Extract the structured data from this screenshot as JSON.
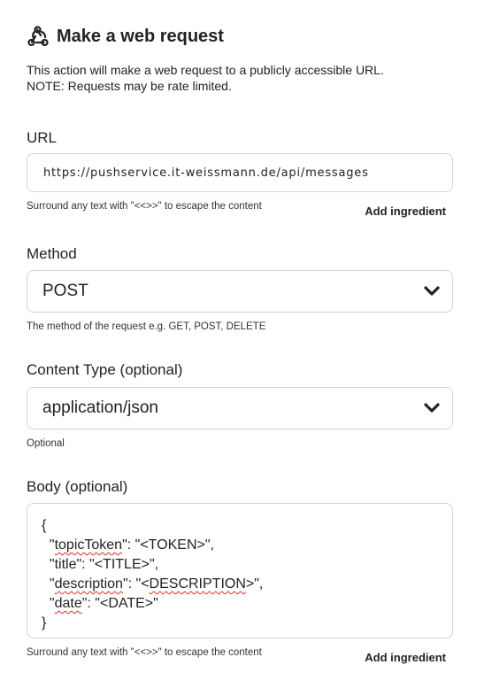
{
  "header": {
    "title": "Make a web request",
    "icon": "webhook-icon"
  },
  "description": {
    "line1": "This action will make a web request to a publicly accessible URL.",
    "line2": "NOTE: Requests may be rate limited."
  },
  "url": {
    "label": "URL",
    "value": "https://pushservice.it-weissmann.de/api/messages",
    "hint": "Surround any text with \"<<>>\" to escape the content",
    "add_ingredient": "Add ingredient"
  },
  "method": {
    "label": "Method",
    "value": "POST",
    "hint": "The method of the request e.g. GET, POST, DELETE"
  },
  "content_type": {
    "label": "Content Type (optional)",
    "value": "application/json",
    "hint": "Optional"
  },
  "body": {
    "label": "Body (optional)",
    "lines": {
      "open": "{",
      "l1_key": "topicToken",
      "l1_value": ": \"<TOKEN>\",",
      "l2": "\"title\": \"<TITLE>\",",
      "l3_key": "description",
      "l3_mid": "\": \"<",
      "l3_word": "DESCRIPTION",
      "l3_end": ">\",",
      "l4_key": "date",
      "l4_value": "\": \"<DATE>\"",
      "close": "}"
    },
    "hint": "Surround any text with \"<<>>\" to escape the content",
    "add_ingredient": "Add ingredient"
  },
  "colors": {
    "border": "#d4d4d4",
    "text": "#222222",
    "spellcheck": "#d93025"
  }
}
